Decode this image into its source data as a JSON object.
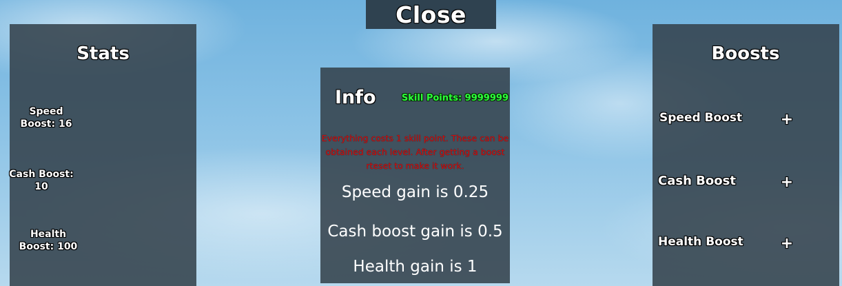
{
  "close_button": {
    "label": "Close"
  },
  "stats": {
    "title": "Stats",
    "speed": {
      "line1": "Speed",
      "line2": "Boost: 16"
    },
    "cash": {
      "line1": "Cash Boost:",
      "line2": "10"
    },
    "health": {
      "line1": "Health",
      "line2": "Boost: 100"
    }
  },
  "info": {
    "title": "Info",
    "skill_points": "Skill Points: 9999999",
    "warning": "Everything costs 1 skill point. These can be obtained each level. After getting a boost rteset to make it work.",
    "gains": [
      "Speed gain is 0.25",
      "Cash boost gain is 0.5",
      "Health gain is 1"
    ]
  },
  "boosts": {
    "title": "Boosts",
    "items": [
      {
        "label": "Speed Boost",
        "button": "+"
      },
      {
        "label": "Cash Boost",
        "button": "+"
      },
      {
        "label": "Health Boost",
        "button": "+"
      }
    ]
  },
  "colors": {
    "panel": "#34424c",
    "skill_points_text": "#2cff3a",
    "warning_text": "#d10f0f"
  }
}
